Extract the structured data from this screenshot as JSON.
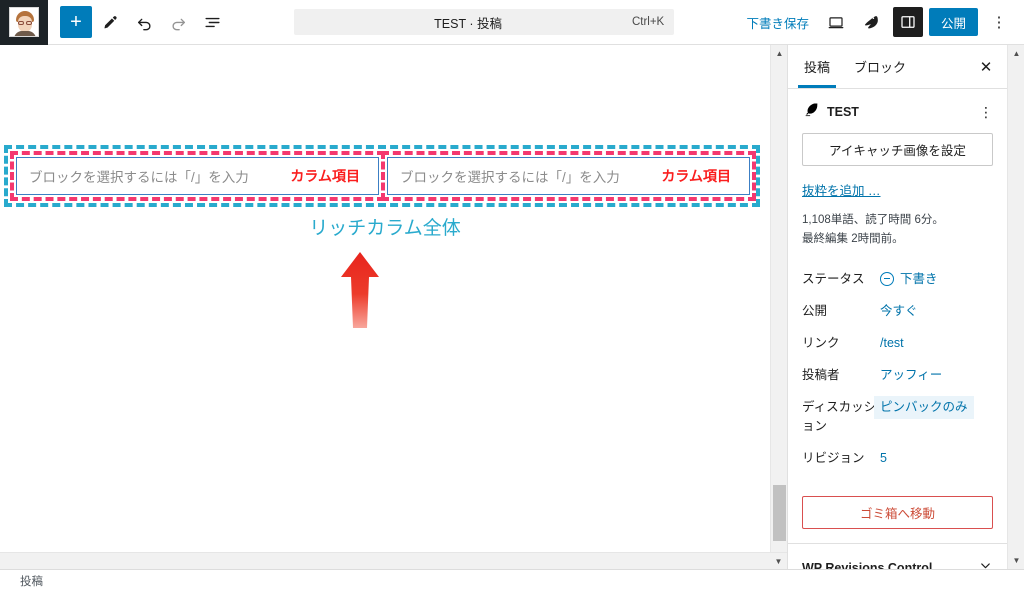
{
  "topbar": {
    "avatar_name": "user-avatar",
    "add_block_label": "+",
    "tools_icon": "pencil-icon",
    "undo_icon": "undo-icon",
    "redo_icon": "redo-icon",
    "list_view_icon": "list-view-icon",
    "command_bar": {
      "title": "TEST · 投稿",
      "shortcut": "Ctrl+K"
    },
    "save_draft_label": "下書き保存",
    "preview_icon": "desktop-preview-icon",
    "jetpack_icon": "jetpack-icon",
    "settings_toggle_icon": "settings-sidebar-icon",
    "publish_label": "公開",
    "more_menu_icon": "kebab-menu-icon"
  },
  "editor": {
    "annotations": {
      "outer_label": "リッチカラム全体",
      "outer_color": "#29aacd",
      "column_label": "カラム項目",
      "column_color": "#fa1e1e",
      "column_border_color": "#f4386f",
      "arrow_color": "#e32222"
    },
    "columns": [
      {
        "placeholder": "ブロックを選択するには「/」を入力"
      },
      {
        "placeholder": "ブロックを選択するには「/」を入力"
      }
    ]
  },
  "sidebar": {
    "tabs": [
      {
        "label": "投稿",
        "active": true
      },
      {
        "label": "ブロック",
        "active": false
      }
    ],
    "close_icon": "close-icon",
    "post": {
      "type_icon": "post-quill-icon",
      "title": "TEST",
      "kebab": "⋮",
      "featured_image_label": "アイキャッチ画像を設定",
      "excerpt_link": "抜粋を追加 …",
      "word_count_line": "1,108単語、読了時間 6分。",
      "last_edited_line": "最終編集 2時間前。"
    },
    "rows": [
      {
        "key": "ステータス",
        "value": "下書き",
        "icon": "status-circle-icon",
        "highlight": false
      },
      {
        "key": "公開",
        "value": "今すぐ",
        "icon": "",
        "highlight": false
      },
      {
        "key": "リンク",
        "value": "/test",
        "icon": "",
        "highlight": false
      },
      {
        "key": "投稿者",
        "value": "アッフィー",
        "icon": "",
        "highlight": false
      },
      {
        "key": "ディスカッション",
        "value": "ピンバックのみ",
        "icon": "",
        "highlight": true
      },
      {
        "key": "リビジョン",
        "value": "5",
        "icon": "",
        "highlight": false
      }
    ],
    "trash_label": "ゴミ箱へ移動",
    "panels": [
      {
        "title": "WP Revisions Control",
        "chevron": "chevron-down-icon"
      }
    ]
  },
  "bottombar": {
    "label": "投稿"
  },
  "colors": {
    "accent_blue": "#007cba",
    "link_blue": "#0073aa",
    "teal": "#29aacd",
    "pink": "#f4386f",
    "red": "#fa1e1e",
    "trash_red": "#cc4b37"
  }
}
